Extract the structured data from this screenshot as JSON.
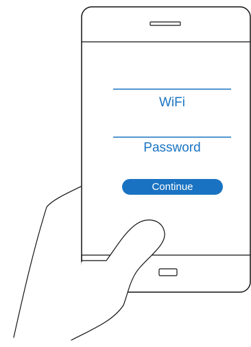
{
  "login_form": {
    "wifi_field_label": "WiFi",
    "password_field_label": "Password",
    "continue_button_label": "Continue"
  },
  "colors": {
    "accent": "#1a73c2",
    "outline": "#111111",
    "button_text": "#ffffff"
  },
  "icons": [
    "phone-speaker-icon",
    "phone-home-button-icon"
  ]
}
